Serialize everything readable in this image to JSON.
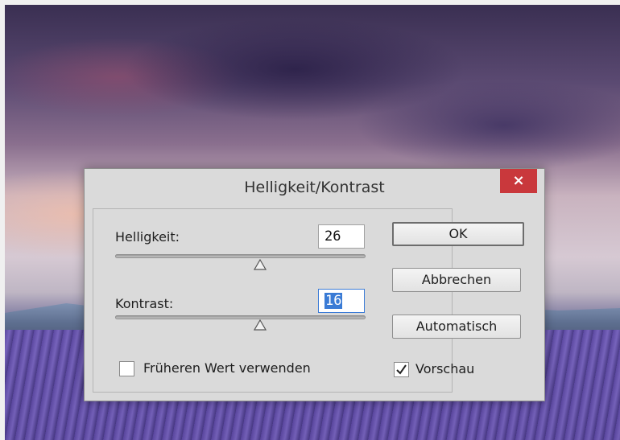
{
  "dialog": {
    "title": "Helligkeit/Kontrast",
    "close_icon": "×",
    "brightness": {
      "label": "Helligkeit:",
      "value": "26",
      "slider_fraction": 0.58
    },
    "contrast": {
      "label": "Kontrast:",
      "value": "16",
      "slider_fraction": 0.58
    },
    "legacy_checkbox": {
      "label": "Früheren Wert verwenden",
      "checked": false
    },
    "buttons": {
      "ok": "OK",
      "cancel": "Abbrechen",
      "auto": "Automatisch"
    },
    "preview_checkbox": {
      "label": "Vorschau",
      "checked": true
    }
  },
  "colors": {
    "close_button": "#c9383c",
    "selection": "#3a7bd5"
  }
}
